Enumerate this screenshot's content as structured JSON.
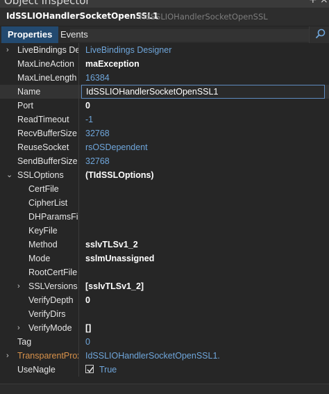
{
  "window": {
    "title": "Object Inspector",
    "pin_glyph": "+",
    "close_glyph": "×"
  },
  "component": {
    "name": "IdSSLIOHandlerSocketOpenSSL1",
    "type": "TIdSSLIOHandlerSocketOpenSSL"
  },
  "tabs": [
    {
      "label": "Properties",
      "active": true
    },
    {
      "label": "Events",
      "active": false
    }
  ],
  "properties": [
    {
      "name": "LiveBindings Designer",
      "value": "LiveBindings Designer",
      "style": "default",
      "expander": "›",
      "indent": 0
    },
    {
      "name": "MaxLineAction",
      "value": "maException",
      "style": "bold",
      "expander": "",
      "indent": 0
    },
    {
      "name": "MaxLineLength",
      "value": "16384",
      "style": "default",
      "expander": "",
      "indent": 0
    },
    {
      "name": "Name",
      "value": "IdSSLIOHandlerSocketOpenSSL1",
      "style": "plain",
      "expander": "",
      "indent": 0,
      "selected": true
    },
    {
      "name": "Port",
      "value": "0",
      "style": "bold",
      "expander": "",
      "indent": 0
    },
    {
      "name": "ReadTimeout",
      "value": "-1",
      "style": "default",
      "expander": "",
      "indent": 0
    },
    {
      "name": "RecvBufferSize",
      "value": "32768",
      "style": "default",
      "expander": "",
      "indent": 0
    },
    {
      "name": "ReuseSocket",
      "value": "rsOSDependent",
      "style": "default",
      "expander": "",
      "indent": 0
    },
    {
      "name": "SendBufferSize",
      "value": "32768",
      "style": "default",
      "expander": "",
      "indent": 0
    },
    {
      "name": "SSLOptions",
      "value": "(TIdSSLOptions)",
      "style": "bold",
      "expander": "⌄",
      "indent": 0
    },
    {
      "name": "CertFile",
      "value": "",
      "style": "plain",
      "expander": "",
      "indent": 1
    },
    {
      "name": "CipherList",
      "value": "",
      "style": "plain",
      "expander": "",
      "indent": 1
    },
    {
      "name": "DHParamsFile",
      "value": "",
      "style": "plain",
      "expander": "",
      "indent": 1
    },
    {
      "name": "KeyFile",
      "value": "",
      "style": "plain",
      "expander": "",
      "indent": 1
    },
    {
      "name": "Method",
      "value": "sslvTLSv1_2",
      "style": "bold",
      "expander": "",
      "indent": 1
    },
    {
      "name": "Mode",
      "value": "sslmUnassigned",
      "style": "bold",
      "expander": "",
      "indent": 1
    },
    {
      "name": "RootCertFile",
      "value": "",
      "style": "plain",
      "expander": "",
      "indent": 1
    },
    {
      "name": "SSLVersions",
      "value": "[sslvTLSv1_2]",
      "style": "bold",
      "expander": "›",
      "indent": 1
    },
    {
      "name": "VerifyDepth",
      "value": "0",
      "style": "bold",
      "expander": "",
      "indent": 1
    },
    {
      "name": "VerifyDirs",
      "value": "",
      "style": "plain",
      "expander": "",
      "indent": 1
    },
    {
      "name": "VerifyMode",
      "value": "[]",
      "style": "bold",
      "expander": "›",
      "indent": 1
    },
    {
      "name": "Tag",
      "value": "0",
      "style": "default",
      "expander": "",
      "indent": 0
    },
    {
      "name": "TransparentProxy",
      "value": "IdSSLIOHandlerSocketOpenSSL1.",
      "style": "default",
      "expander": "›",
      "indent": 0,
      "orange": true
    },
    {
      "name": "UseNagle",
      "value": "True",
      "style": "checkbox",
      "checked": true,
      "expander": "",
      "indent": 0
    }
  ],
  "colors": {
    "accent": "#234a70",
    "default_value": "#6fa6db",
    "linked_property": "#d9924a",
    "background": "#262626"
  },
  "icons": {
    "search": "search-icon",
    "expand": "chevron-right-icon",
    "collapse": "chevron-down-icon",
    "checkbox": "checkmark-icon"
  }
}
